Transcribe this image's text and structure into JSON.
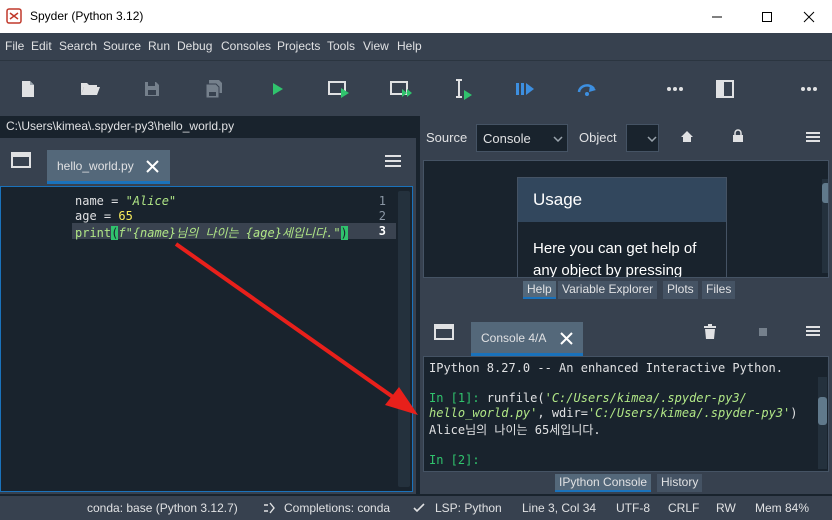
{
  "window": {
    "title": "Spyder (Python 3.12)"
  },
  "menu": [
    "File",
    "Edit",
    "Search",
    "Source",
    "Run",
    "Debug",
    "Consoles",
    "Projects",
    "Tools",
    "View",
    "Help"
  ],
  "toolbar": {
    "icons": [
      "new-file-icon",
      "open-folder-icon",
      "save-icon",
      "save-all-icon",
      "run-icon",
      "run-cell-icon",
      "run-cell-advance-icon",
      "run-selection-icon",
      "debug-icon",
      "step-over-icon",
      "more-icon",
      "maximize-pane-icon",
      "more-icon"
    ]
  },
  "editor": {
    "path": "C:\\Users\\kimea\\.spyder-py3\\hello_world.py",
    "tab_label": "hello_world.py",
    "lines": [
      {
        "num": "1",
        "tokens": [
          [
            "name = ",
            "#e0e1e3"
          ],
          [
            "\"Alice\"",
            "#b0e686"
          ]
        ]
      },
      {
        "num": "2",
        "tokens": [
          [
            "age = ",
            "#e0e1e3"
          ],
          [
            "65",
            "#faed5c"
          ]
        ]
      },
      {
        "num": "3",
        "tokens": [
          [
            "print",
            "#b0e686"
          ],
          [
            "(",
            "#ffffff"
          ],
          [
            "f\"{name}님의 나이는 {age}세입니다.\"",
            "#b0e686"
          ],
          [
            ")",
            "#ffffff"
          ]
        ]
      }
    ],
    "current_line": "3"
  },
  "help": {
    "source_label": "Source",
    "source_value": "Console",
    "object_label": "Object",
    "object_value": "",
    "usage_title": "Usage",
    "usage_text": "Here you can get help of any object by pressing",
    "tabs": [
      "Help",
      "Variable Explorer",
      "Plots",
      "Files"
    ],
    "active_tab": "Help"
  },
  "console": {
    "tab_label": "Console 4/A",
    "banner": "IPython 8.27.0 -- An enhanced Interactive Python.",
    "in1_prompt": "In [1]: ",
    "in1_code_a": "runfile(",
    "in1_path": "'C:/Users/kimea/.spyder-py3/",
    "in1_path2": "hello_world.py'",
    "in1_wdir": ", wdir=",
    "in1_wdir_val": "'C:/Users/kimea/.spyder-py3'",
    "in1_close": ")",
    "output": "Alice님의 나이는 65세입니다.",
    "in2_prompt": "In [2]:",
    "tabs": [
      "IPython Console",
      "History"
    ],
    "active_tab": "IPython Console"
  },
  "status": {
    "env": "conda: base (Python 3.12.7)",
    "completions": "Completions: conda",
    "lsp": "LSP: Python",
    "position": "Line 3, Col 34",
    "encoding": "UTF-8",
    "eol": "CRLF",
    "mode": "RW",
    "memory": "Mem 84%"
  },
  "colors": {
    "accent": "#1a72bb",
    "run_green": "#30c36d",
    "debug_blue": "#3d8fe0",
    "arrow_red": "#e8201b",
    "prompt_green": "#30c36d"
  }
}
